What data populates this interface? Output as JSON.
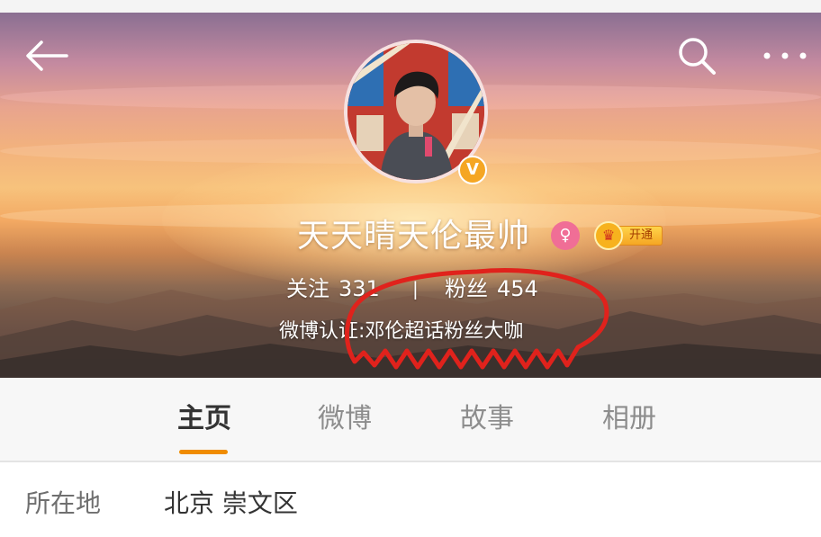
{
  "profile": {
    "username": "天天晴天伦最帅",
    "gender_icon": "female-icon",
    "verified_icon_text": "V",
    "vip_badge": {
      "crown_icon": "crown-icon",
      "label": "开通"
    },
    "stats": {
      "following_label": "关注",
      "following_count": "331",
      "divider": "|",
      "followers_label": "粉丝",
      "followers_count": "454"
    },
    "verification": "微博认证:邓伦超话粉丝大咖"
  },
  "nav": {
    "back_icon": "back-arrow-icon",
    "search_icon": "search-icon",
    "more_icon": "more-dots-icon"
  },
  "tabs": [
    {
      "label": "主页",
      "active": true
    },
    {
      "label": "微博",
      "active": false
    },
    {
      "label": "故事",
      "active": false
    },
    {
      "label": "相册",
      "active": false
    }
  ],
  "info": {
    "location_label": "所在地",
    "location_value": "北京 崇文区"
  },
  "colors": {
    "accent": "#f08c00",
    "verified": "#f5a623",
    "annotation": "#e0221c",
    "gender": "#f06e96"
  }
}
